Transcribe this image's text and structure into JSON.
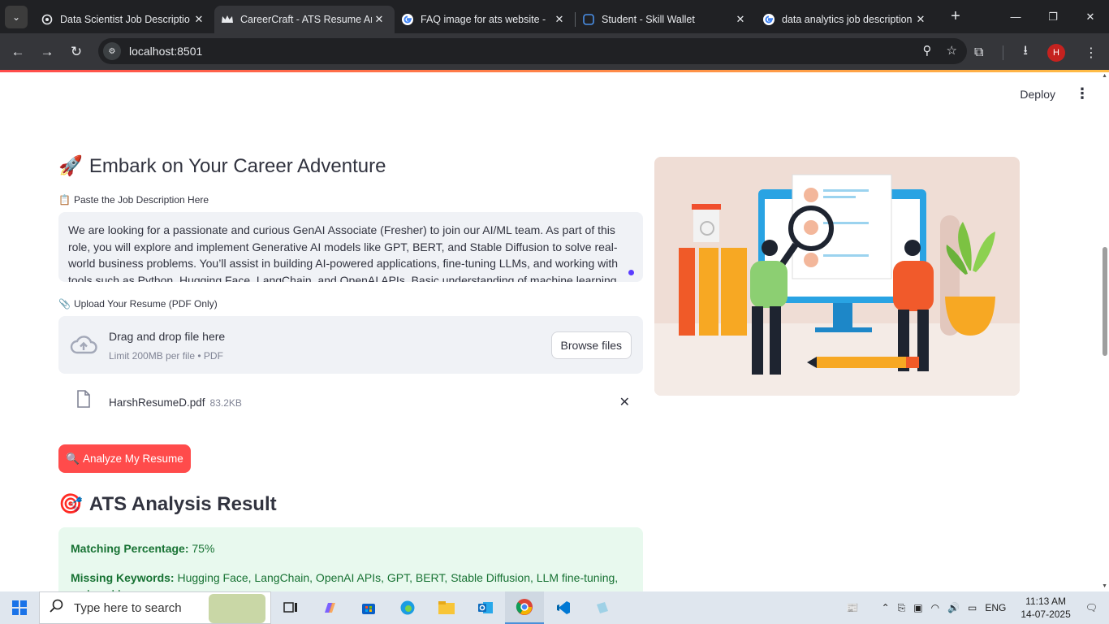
{
  "browser": {
    "tabs": [
      {
        "title": "Data Scientist Job Descriptio",
        "icon": "openai-icon",
        "active": false
      },
      {
        "title": "CareerCraft - ATS Resume Ar",
        "icon": "crown-icon",
        "active": true
      },
      {
        "title": "FAQ image for ats website - ",
        "icon": "google-icon",
        "active": false
      },
      {
        "title": "Student - Skill Wallet",
        "icon": "skill-wallet-icon",
        "active": false
      },
      {
        "title": "data analytics job description",
        "icon": "google-icon",
        "active": false
      }
    ],
    "url": "localhost:8501",
    "avatar_letter": "H"
  },
  "app": {
    "deploy_label": "Deploy",
    "heading": "Embark on Your Career Adventure",
    "heading_emoji": "🚀",
    "jd_label": "Paste the Job Description Here",
    "jd_emoji": "📋",
    "jd_text": "We are looking for a passionate and curious GenAI Associate (Fresher) to join our AI/ML team. As part of this role, you will explore and implement Generative AI models like GPT, BERT, and Stable Diffusion to solve real-world business problems. You’ll assist in building AI-powered applications, fine-tuning LLMs, and working with tools such as Python, Hugging Face, LangChain, and OpenAI APIs. Basic understanding of machine learning, NLP, or deep",
    "upload_label": "Upload Your Resume (PDF Only)",
    "upload_emoji": "📎",
    "dropzone_title": "Drag and drop file here",
    "dropzone_limit": "Limit 200MB per file • PDF",
    "browse_label": "Browse files",
    "file_name": "HarshResumeD.pdf",
    "file_size": "83.2KB",
    "analyze_label": "Analyze My Resume",
    "analyze_emoji": "🔍",
    "result_heading": "ATS Analysis Result",
    "result_emoji": "🎯",
    "match_label": "Matching Percentage:",
    "match_value": "75%",
    "missing_label": "Missing Keywords:",
    "missing_value": "Hugging Face, LangChain, OpenAI APIs, GPT, BERT, Stable Diffusion, LLM fine-tuning, real-world"
  },
  "taskbar": {
    "search_placeholder": "Type here to search",
    "language": "ENG",
    "time": "11:13 AM",
    "date": "14-07-2025"
  },
  "colors": {
    "primary": "#ff4b4b",
    "success_bg": "#e8f9ee",
    "success_text": "#177233",
    "tab_bar": "#202124"
  }
}
